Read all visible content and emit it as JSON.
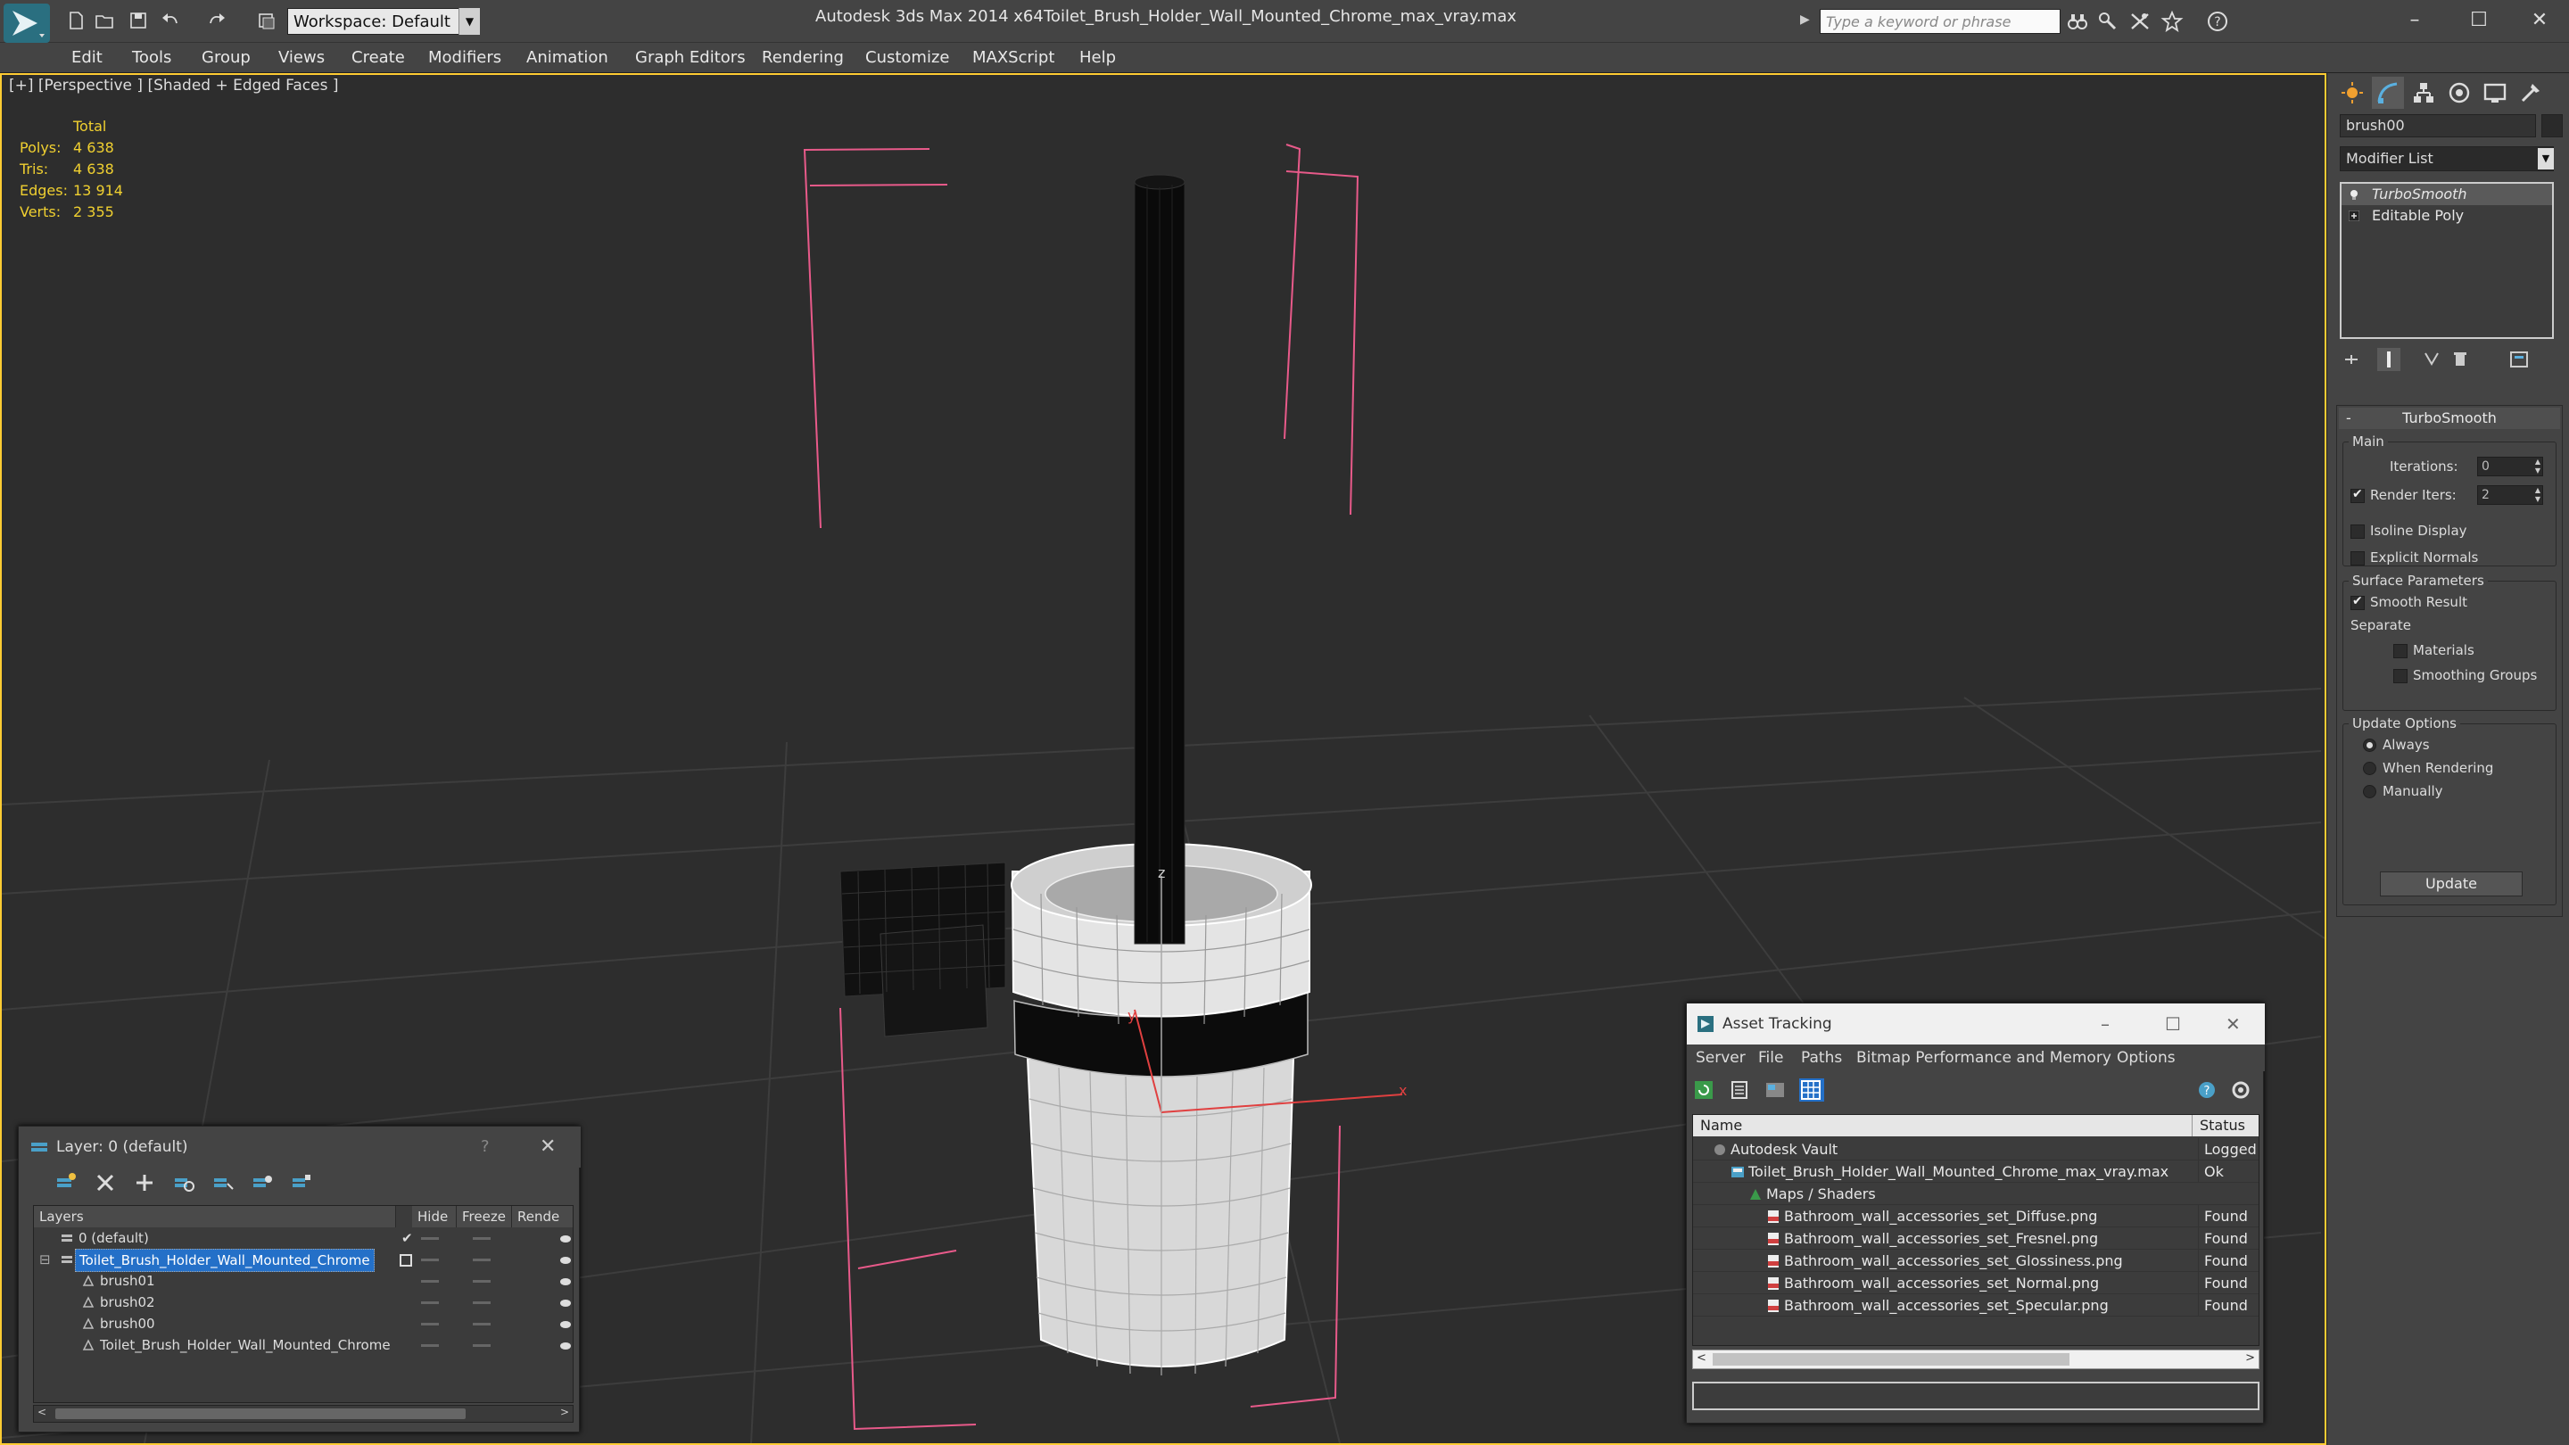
{
  "titlebar": {
    "workspace": "Workspace: Default",
    "app_title": "Autodesk 3ds Max  2014 x64",
    "file_title": "Toilet_Brush_Holder_Wall_Mounted_Chrome_max_vray.max",
    "search_placeholder": "Type a keyword or phrase",
    "quick_access_icons": [
      "new-icon",
      "open-icon",
      "save-icon",
      "undo-icon",
      "redo-icon",
      "project-folder-icon"
    ],
    "right_icons": [
      "binoculars-icon",
      "key-tools-icon",
      "communication-icon",
      "star-icon",
      "help-icon"
    ],
    "window_controls": [
      "–",
      "☐",
      "✕"
    ]
  },
  "menubar": {
    "items": [
      "Edit",
      "Tools",
      "Group",
      "Views",
      "Create",
      "Modifiers",
      "Animation",
      "Graph Editors",
      "Rendering",
      "Customize",
      "MAXScript",
      "Help"
    ]
  },
  "viewport": {
    "label": "[+] [Perspective ] [Shaded + Edged Faces ]",
    "stats": {
      "header": "Total",
      "rows": [
        {
          "label": "Polys:",
          "value": "4 638"
        },
        {
          "label": "Tris:",
          "value": "4 638"
        },
        {
          "label": "Edges:",
          "value": "13 914"
        },
        {
          "label": "Verts:",
          "value": "2 355"
        }
      ]
    },
    "axis_labels": {
      "y": "y",
      "z": "z",
      "x": "x"
    },
    "colors": {
      "background": "#2d2d2d",
      "border": "#ffcc33",
      "grid": "#3c3c3c",
      "bracket": "#e85a8a",
      "stats": "#f0d030"
    }
  },
  "command_panel": {
    "tabs": [
      "create-tab-icon",
      "modify-tab-icon",
      "hierarchy-tab-icon",
      "motion-tab-icon",
      "display-tab-icon",
      "utilities-tab-icon"
    ],
    "object_name": "brush00",
    "modifier_list": "Modifier List",
    "stack": [
      {
        "label": "TurboSmooth",
        "selected": true
      },
      {
        "label": "Editable Poly",
        "selected": false
      }
    ],
    "turbosmooth": {
      "title": "TurboSmooth",
      "main_group": "Main",
      "iterations_label": "Iterations:",
      "iterations_value": "0",
      "render_iters_label": "Render Iters:",
      "render_iters_value": "2",
      "render_iters_checked": true,
      "isoline_label": "Isoline Display",
      "explicit_label": "Explicit Normals",
      "surface_group": "Surface Parameters",
      "smooth_result_label": "Smooth Result",
      "separate_label": "Separate",
      "materials_label": "Materials",
      "smoothing_groups_label": "Smoothing Groups",
      "update_group": "Update Options",
      "always_label": "Always",
      "when_rendering_label": "When Rendering",
      "manually_label": "Manually",
      "update_button": "Update"
    }
  },
  "layer_window": {
    "title": "Layer: 0 (default)",
    "help": "?",
    "close": "✕",
    "headers": [
      "Layers",
      "Hide",
      "Freeze",
      "Rende"
    ],
    "rows": [
      {
        "name": "0 (default)",
        "indent": 1,
        "type": "layer",
        "selected": false
      },
      {
        "name": "Toilet_Brush_Holder_Wall_Mounted_Chrome",
        "indent": 1,
        "type": "layer",
        "selected": true
      },
      {
        "name": "brush01",
        "indent": 2,
        "type": "object",
        "selected": false
      },
      {
        "name": "brush02",
        "indent": 2,
        "type": "object",
        "selected": false
      },
      {
        "name": "brush00",
        "indent": 2,
        "type": "object",
        "selected": false
      },
      {
        "name": "Toilet_Brush_Holder_Wall_Mounted_Chrome",
        "indent": 2,
        "type": "object",
        "selected": false
      }
    ]
  },
  "asset_window": {
    "title": "Asset Tracking",
    "menu": [
      "Server",
      "File",
      "Paths",
      "Bitmap Performance and Memory",
      "Options"
    ],
    "headers": [
      "Name",
      "Status"
    ],
    "rows": [
      {
        "name": "Autodesk Vault",
        "status": "Logged Out",
        "indent": 1,
        "icon": "vault"
      },
      {
        "name": "Toilet_Brush_Holder_Wall_Mounted_Chrome_max_vray.max",
        "status": "Ok",
        "indent": 2,
        "icon": "max-file"
      },
      {
        "name": "Maps / Shaders",
        "status": "",
        "indent": 3,
        "icon": "maps"
      },
      {
        "name": "Bathroom_wall_accessories_set_Diffuse.png",
        "status": "Found",
        "indent": 4,
        "icon": "png"
      },
      {
        "name": "Bathroom_wall_accessories_set_Fresnel.png",
        "status": "Found",
        "indent": 4,
        "icon": "png"
      },
      {
        "name": "Bathroom_wall_accessories_set_Glossiness.png",
        "status": "Found",
        "indent": 4,
        "icon": "png"
      },
      {
        "name": "Bathroom_wall_accessories_set_Normal.png",
        "status": "Found",
        "indent": 4,
        "icon": "png"
      },
      {
        "name": "Bathroom_wall_accessories_set_Specular.png",
        "status": "Found",
        "indent": 4,
        "icon": "png"
      }
    ]
  }
}
